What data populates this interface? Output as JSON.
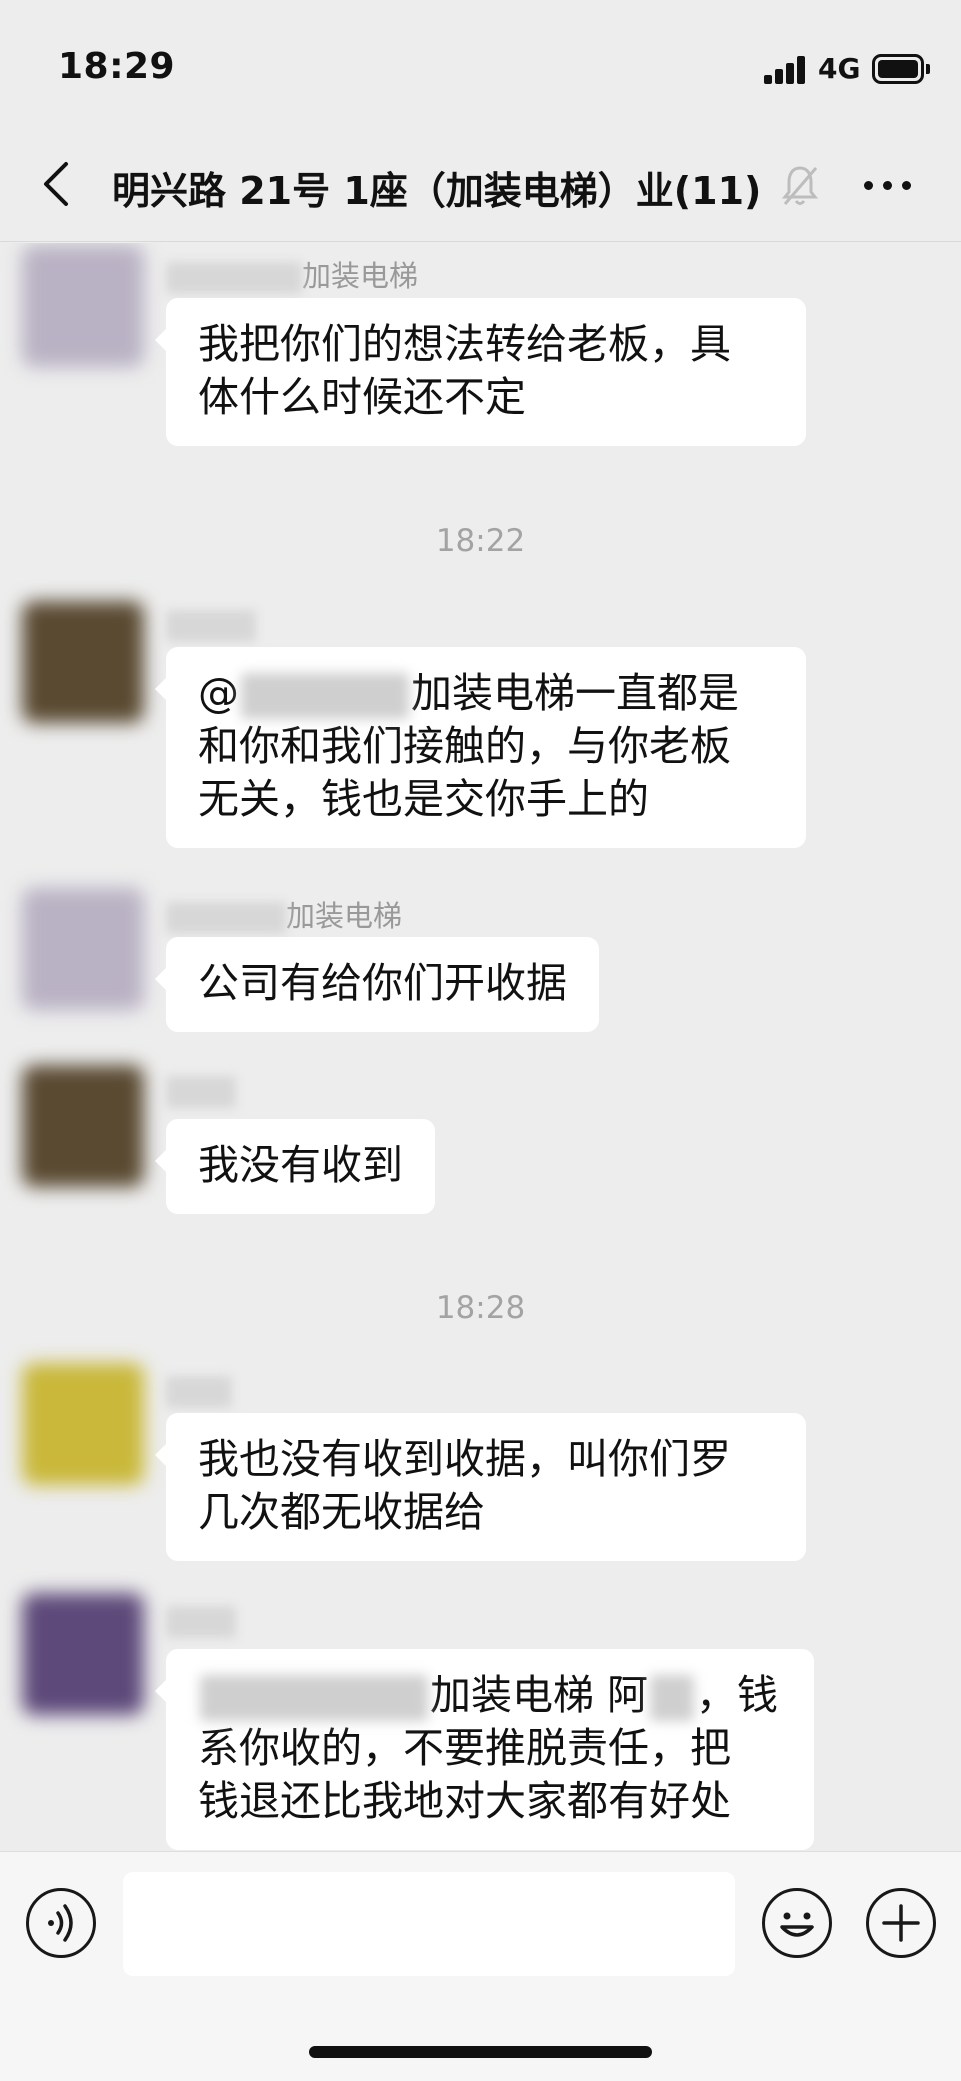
{
  "status_bar": {
    "time": "18:29",
    "network": "4G",
    "icons": [
      "signal-icon",
      "battery-icon"
    ]
  },
  "nav": {
    "title": "明兴路 21号 1座（加装电梯）业(11)",
    "icons": [
      "back-icon",
      "mute-bell-icon",
      "more-icon"
    ]
  },
  "chat": {
    "messages": [
      {
        "sender_suffix": "加装电梯",
        "avatar_color": "#b9b2c4",
        "lines": [
          "我把你们的想法转给老板，具",
          "体什么时候还不定"
        ]
      },
      {
        "divider": "18:22"
      },
      {
        "sender_suffix": "",
        "avatar_color": "#5a4a32",
        "lines_prefix": "@",
        "line1_suffix": "加装电梯一直都是",
        "lines": [
          "和你和我们接触的，与你老板",
          "无关，钱也是交你手上的"
        ]
      },
      {
        "sender_suffix": "加装电梯",
        "avatar_color": "#b9b2c4",
        "lines": [
          "公司有给你们开收据"
        ]
      },
      {
        "sender_suffix": "",
        "avatar_color": "#5a4a32",
        "lines": [
          "我没有收到"
        ]
      },
      {
        "divider": "18:28"
      },
      {
        "sender_suffix": "",
        "avatar_color": "#c9b83a",
        "lines": [
          "我也没有收到收据，叫你们罗",
          "几次都无收据给"
        ]
      },
      {
        "sender_suffix": "",
        "avatar_color": "#5e4a7a",
        "line1_middle": "加装电梯 阿",
        "line1_end": "，钱",
        "lines": [
          "系你收的，不要推脱责任，把",
          "钱退还比我地对大家都有好处"
        ]
      }
    ]
  },
  "input_bar": {
    "placeholder": "",
    "icons": [
      "voice-icon",
      "emoji-icon",
      "plus-icon"
    ]
  }
}
